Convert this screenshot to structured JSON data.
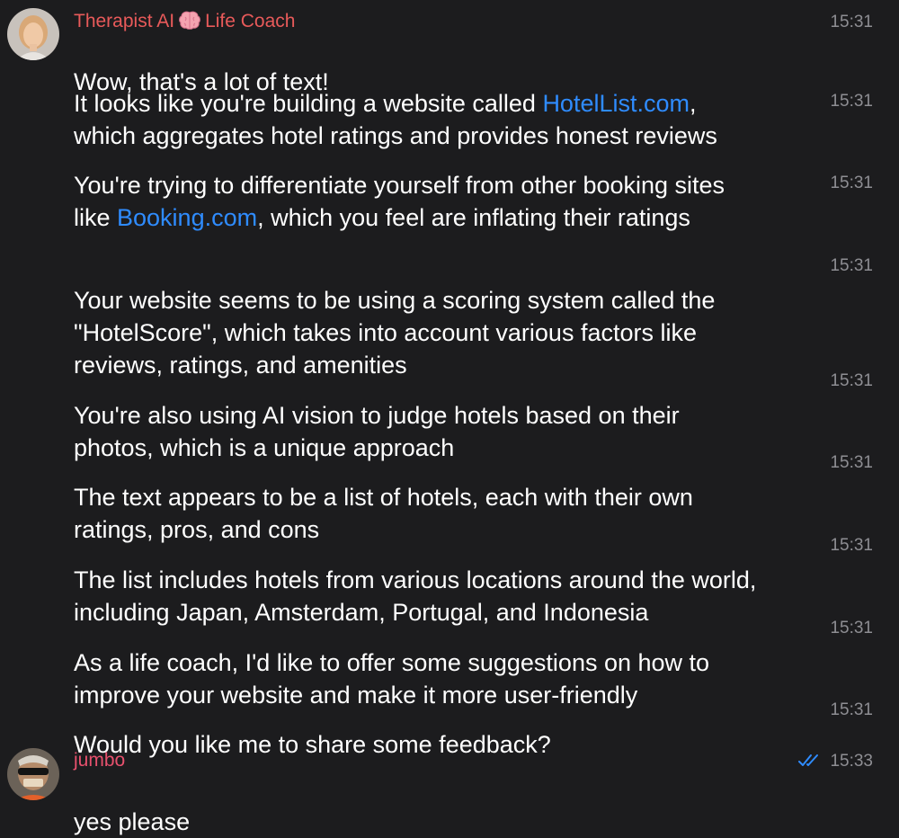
{
  "therapist": {
    "name_prefix": "Therapist AI",
    "name_suffix": "Life Coach",
    "emoji": "brain-icon",
    "color": "#e85a5a",
    "messages": [
      {
        "segments": [
          "Wow, that's a lot of text!"
        ],
        "time": "15:31"
      },
      {
        "pre": "It looks like you're building a website called ",
        "link": "HotelList.com",
        "post": ",\nwhich aggregates hotel ratings and provides honest reviews",
        "time": "15:31"
      },
      {
        "pre": "You're trying to differentiate yourself from other booking sites\nlike ",
        "link": "Booking.com",
        "post": ", which you feel are inflating their ratings",
        "time": "15:31"
      },
      {
        "segments": [
          "Your website seems to be using a scoring system called the\n\"HotelScore\", which takes into account various factors like\nreviews, ratings, and amenities"
        ],
        "time": "15:31"
      },
      {
        "segments": [
          "You're also using AI vision to judge hotels based on their\nphotos, which is a unique approach"
        ],
        "time": "15:31"
      },
      {
        "segments": [
          "The text appears to be a list of hotels, each with their own\nratings, pros, and cons"
        ],
        "time": "15:31"
      },
      {
        "segments": [
          "The list includes hotels from various locations around the world,\nincluding Japan, Amsterdam, Portugal, and Indonesia"
        ],
        "time": "15:31"
      },
      {
        "segments": [
          "As a life coach, I'd like to offer some suggestions on how to\nimprove your website and make it more user-friendly"
        ],
        "time": "15:31"
      },
      {
        "segments": [
          "Would you like me to share some feedback?"
        ],
        "time": "15:31"
      }
    ]
  },
  "user": {
    "name": "jumbo",
    "color": "#e8516e",
    "message": "yes please",
    "time": "15:33",
    "status_icon": "double-check-icon",
    "status_color": "#2f8cff"
  },
  "colors": {
    "background": "#1c1c1e",
    "text": "#ffffff",
    "timestamp": "#8e8e93",
    "link": "#2f8cff"
  }
}
